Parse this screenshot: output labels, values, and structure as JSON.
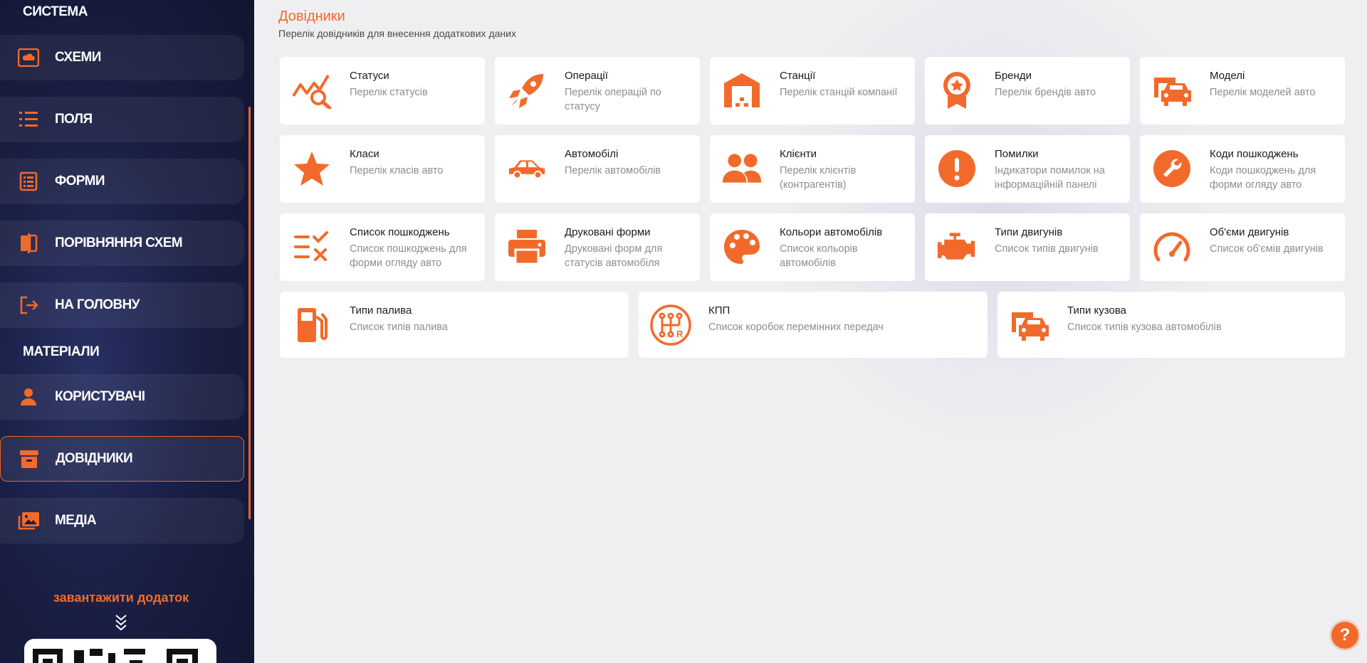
{
  "colors": {
    "accent": "#f26a2b",
    "sidebar_bg": "#1a1f45",
    "page_bg": "#efeff1"
  },
  "sidebar": {
    "section_system": "СИСТЕМА",
    "section_materials": "МАТЕРІАЛИ",
    "items": [
      {
        "label": "СХЕМИ",
        "icon": "cloud-folder-icon"
      },
      {
        "label": "ПОЛЯ",
        "icon": "list-icon"
      },
      {
        "label": "ФОРМИ",
        "icon": "form-icon"
      },
      {
        "label": "ПОРІВНЯННЯ СХЕМ",
        "icon": "compare-icon"
      },
      {
        "label": "НА ГОЛОВНУ",
        "icon": "exit-icon"
      },
      {
        "label": "КОРИСТУВАЧІ",
        "icon": "user-icon"
      },
      {
        "label": "ДОВІДНИКИ",
        "icon": "archive-icon",
        "active": true
      },
      {
        "label": "МЕДІА",
        "icon": "images-icon"
      }
    ],
    "download_text": "завантажити додаток"
  },
  "main": {
    "title": "Довідники",
    "subtitle": "Перелік довідників для внесення додаткових даних",
    "cards": [
      {
        "title": "Статуси",
        "desc": "Перелік статусів",
        "icon": "chart-search-icon"
      },
      {
        "title": "Операції",
        "desc": "Перелік операцій по статусу",
        "icon": "rocket-icon"
      },
      {
        "title": "Станції",
        "desc": "Перелік станцій компанії",
        "icon": "garage-icon"
      },
      {
        "title": "Бренди",
        "desc": "Перелік брендів авто",
        "icon": "award-icon"
      },
      {
        "title": "Моделі",
        "desc": "Перелік моделей авто",
        "icon": "car-transfer-icon"
      },
      {
        "title": "Класи",
        "desc": "Перелік класів авто",
        "icon": "star-icon"
      },
      {
        "title": "Автомобілі",
        "desc": "Перелік автомобілів",
        "icon": "car-icon"
      },
      {
        "title": "Клієнти",
        "desc": "Перелік клієнтів (контрагентів)",
        "icon": "people-icon"
      },
      {
        "title": "Помилки",
        "desc": "Індикатори помилок на інформаційній панелі",
        "icon": "exclamation-icon"
      },
      {
        "title": "Коди пошкоджень",
        "desc": "Коди пошкоджень для форми огляду авто",
        "icon": "wrench-icon"
      },
      {
        "title": "Список пошкоджень",
        "desc": "Список пошкоджень для форми огляду авто",
        "icon": "checklist-icon"
      },
      {
        "title": "Друковані форми",
        "desc": "Друковані форм для статусів автомобіля",
        "icon": "printer-icon"
      },
      {
        "title": "Кольори автомобілів",
        "desc": "Список кольорів автомобілів",
        "icon": "palette-icon"
      },
      {
        "title": "Типи двигунів",
        "desc": "Список типів двигунів",
        "icon": "engine-icon"
      },
      {
        "title": "Об'єми двигунів",
        "desc": "Список об'ємів двигунів",
        "icon": "gauge-icon"
      },
      {
        "title": "Типи палива",
        "desc": "Список типів палива",
        "icon": "fuel-icon"
      },
      {
        "title": "КПП",
        "desc": "Список коробок перемінних передач",
        "icon": "gearbox-icon"
      },
      {
        "title": "Типи кузова",
        "desc": "Список типів кузова автомобілів",
        "icon": "car-body-icon"
      }
    ]
  },
  "help": {
    "label": "?"
  }
}
